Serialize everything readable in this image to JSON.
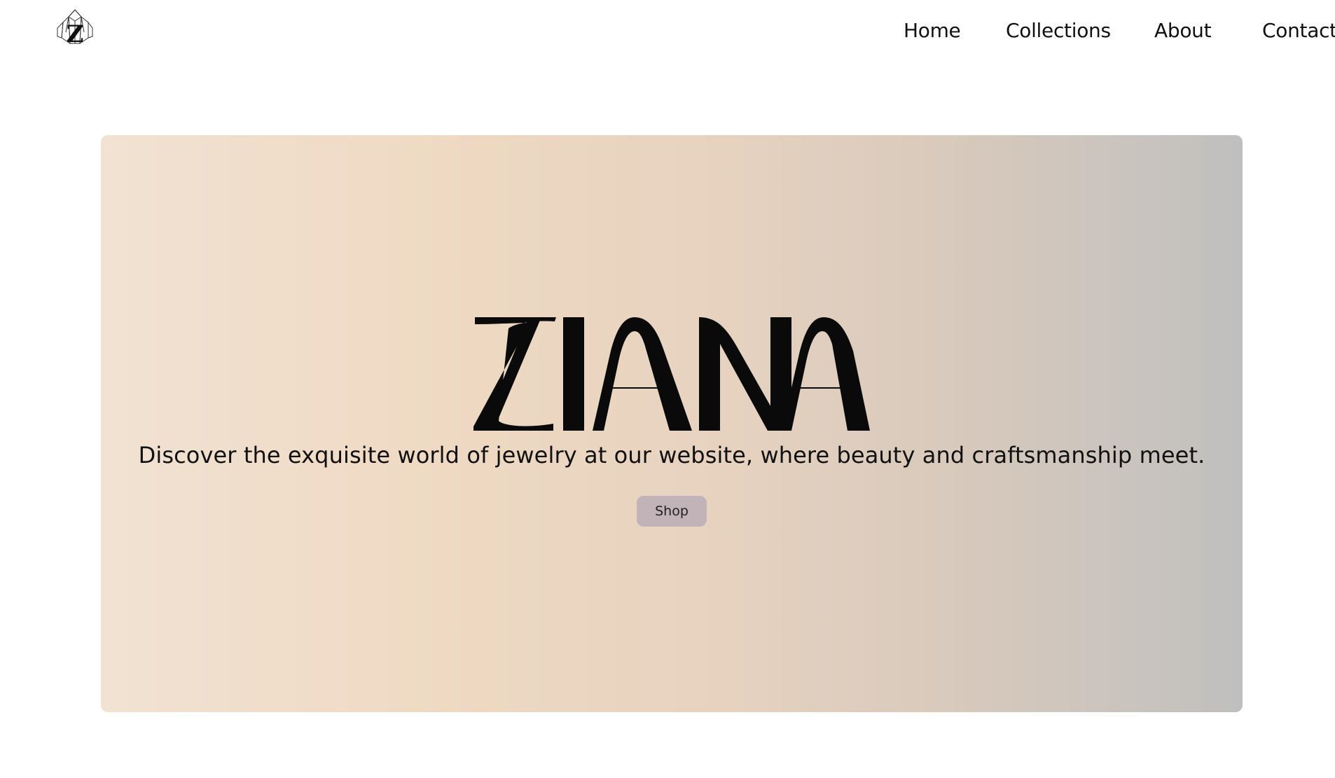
{
  "header": {
    "logo_letter": "Z",
    "logo_icon": "crystal-z-logo-icon",
    "nav": {
      "home": "Home",
      "collections": "Collections",
      "about": "About",
      "contact": "Contact"
    }
  },
  "hero": {
    "brand": "ZIANA",
    "tagline": "Discover the exquisite world of jewelry at our website, where beauty and craftsmanship meet.",
    "cta_label": "Shop"
  },
  "colors": {
    "background": "#ffffff",
    "hero_gradient_start": "#f1e2d2",
    "hero_gradient_mid": "#efd9c3",
    "hero_gradient_end": "#bfbfbf",
    "button": "#c2b3b9",
    "text": "#0b0b0b"
  }
}
